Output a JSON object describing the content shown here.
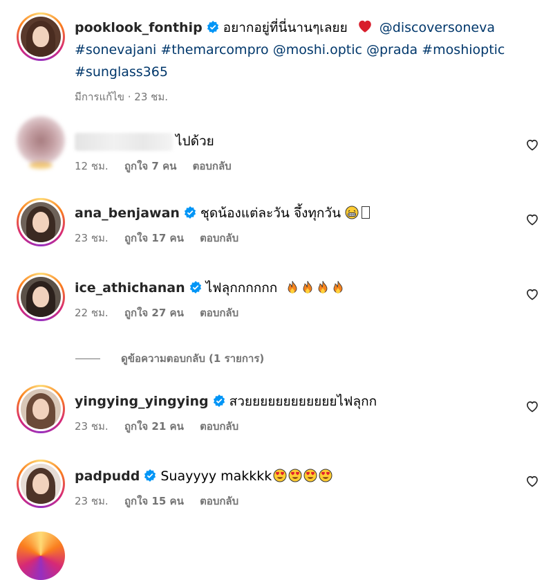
{
  "post": {
    "username": "pooklook_fonthip",
    "caption_text": "อยากอยู่ที่นี่นานๆเลยย",
    "mention1": "@discoversoneva",
    "line2": "#sonevajani #themarcompro @moshi.optic @prada #moshioptic",
    "line3": "#sunglass365",
    "meta": "มีการแก้ไข · 23 ชม."
  },
  "comments": [
    {
      "username": "",
      "text": "ไปด้วย",
      "time": "12 ชม.",
      "likes": "ถูกใจ 7 คน",
      "reply": "ตอบกลับ",
      "verified": false
    },
    {
      "username": "ana_benjawan",
      "text": "ชุดน้องแต่ละวัน จึ้งทุกวัน",
      "time": "23 ชม.",
      "likes": "ถูกใจ 17 คน",
      "reply": "ตอบกลับ",
      "verified": true
    },
    {
      "username": "ice_athichanan",
      "text": "ไฟลุกกกกกก",
      "time": "22 ชม.",
      "likes": "ถูกใจ 27 คน",
      "reply": "ตอบกลับ",
      "verified": true
    },
    {
      "username": "yingying_yingying",
      "text": "สวยยยยยยยยยยยยไฟลุกก",
      "time": "23 ชม.",
      "likes": "ถูกใจ 21 คน",
      "reply": "ตอบกลับ",
      "verified": true
    },
    {
      "username": "padpudd",
      "text": "Suayyyy makkkk",
      "time": "23 ชม.",
      "likes": "ถูกใจ 15 คน",
      "reply": "ตอบกลับ",
      "verified": true
    }
  ],
  "view_replies": "ดูข้อความตอบกลับ (1 รายการ)",
  "icons": {
    "verified": "verified-badge-icon",
    "like": "heart-outline-icon",
    "heart_emoji": "red-heart-emoji",
    "fire": "fire-emoji",
    "grin": "grinning-emoji",
    "heart_eyes": "heart-eyes-emoji"
  },
  "colors": {
    "verified": "#0095f6",
    "link": "#00376b",
    "meta": "#737373"
  }
}
